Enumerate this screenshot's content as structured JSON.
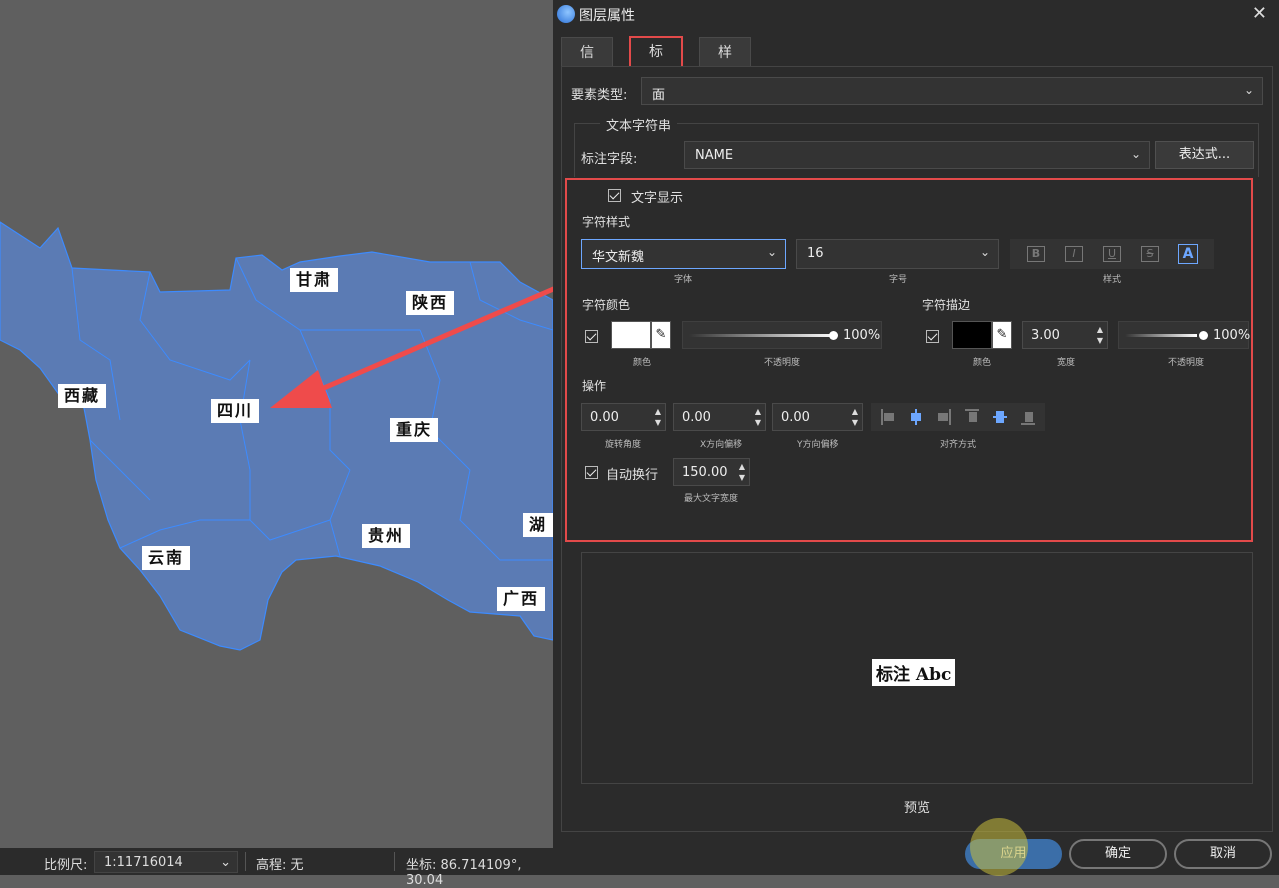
{
  "map": {
    "labels": [
      "甘肃",
      "陕西",
      "西藏",
      "四川",
      "重庆",
      "贵州",
      "云南",
      "广西",
      "湖"
    ]
  },
  "statusbar": {
    "scale_label": "比例尺:",
    "scale_value": "1:11716014",
    "elevation": "高程: 无",
    "coords": "坐标: 86.714109°, 30.04"
  },
  "dialog": {
    "title": "图层属性",
    "tabs": [
      "信息",
      "标注",
      "样式"
    ],
    "active_tab": "标注",
    "feature_type_label": "要素类型:",
    "feature_type_value": "面",
    "text_string_group": "文本字符串",
    "label_field_label": "标注字段:",
    "label_field_value": "NAME",
    "expression_button": "表达式...",
    "text_display_label": "文字显示",
    "char_style_heading": "字符样式",
    "font_value": "华文新魏",
    "font_caption": "字体",
    "size_value": "16",
    "size_caption": "字号",
    "style_caption": "样式",
    "style_buttons": [
      "B",
      "I",
      "U",
      "S",
      "A"
    ],
    "char_color_heading": "字符颜色",
    "color_caption": "颜色",
    "color_opacity": "100%",
    "opacity_caption": "不透明度",
    "char_outline_heading": "字符描边",
    "outline_color_caption": "颜色",
    "outline_width": "3.00",
    "outline_width_caption": "宽度",
    "outline_opacity": "100%",
    "outline_opacity_caption": "不透明度",
    "operation_heading": "操作",
    "rotation": "0.00",
    "rotation_caption": "旋转角度",
    "x_offset": "0.00",
    "x_offset_caption": "X方向偏移",
    "y_offset": "0.00",
    "y_offset_caption": "Y方向偏移",
    "align_caption": "对齐方式",
    "auto_wrap_label": "自动换行",
    "max_width": "150.00",
    "max_width_caption": "最大文字宽度",
    "preview_sample": "标注 Abc",
    "preview_caption": "预览",
    "apply_button": "应用",
    "ok_button": "确定",
    "cancel_button": "取消"
  },
  "colors": {
    "region_fill": "#5b7bb4",
    "region_border": "#3d8bff",
    "highlight": "#e24a4a",
    "arrow": "#ef4b4b",
    "char_color": "#ffffff",
    "outline_color": "#000000"
  },
  "icons": {
    "close": "close-icon",
    "eyedropper": "eyedropper-icon",
    "chevron": "chevron-down-icon"
  },
  "opacity": {
    "char_color": 1.0,
    "outline": 1.0
  }
}
